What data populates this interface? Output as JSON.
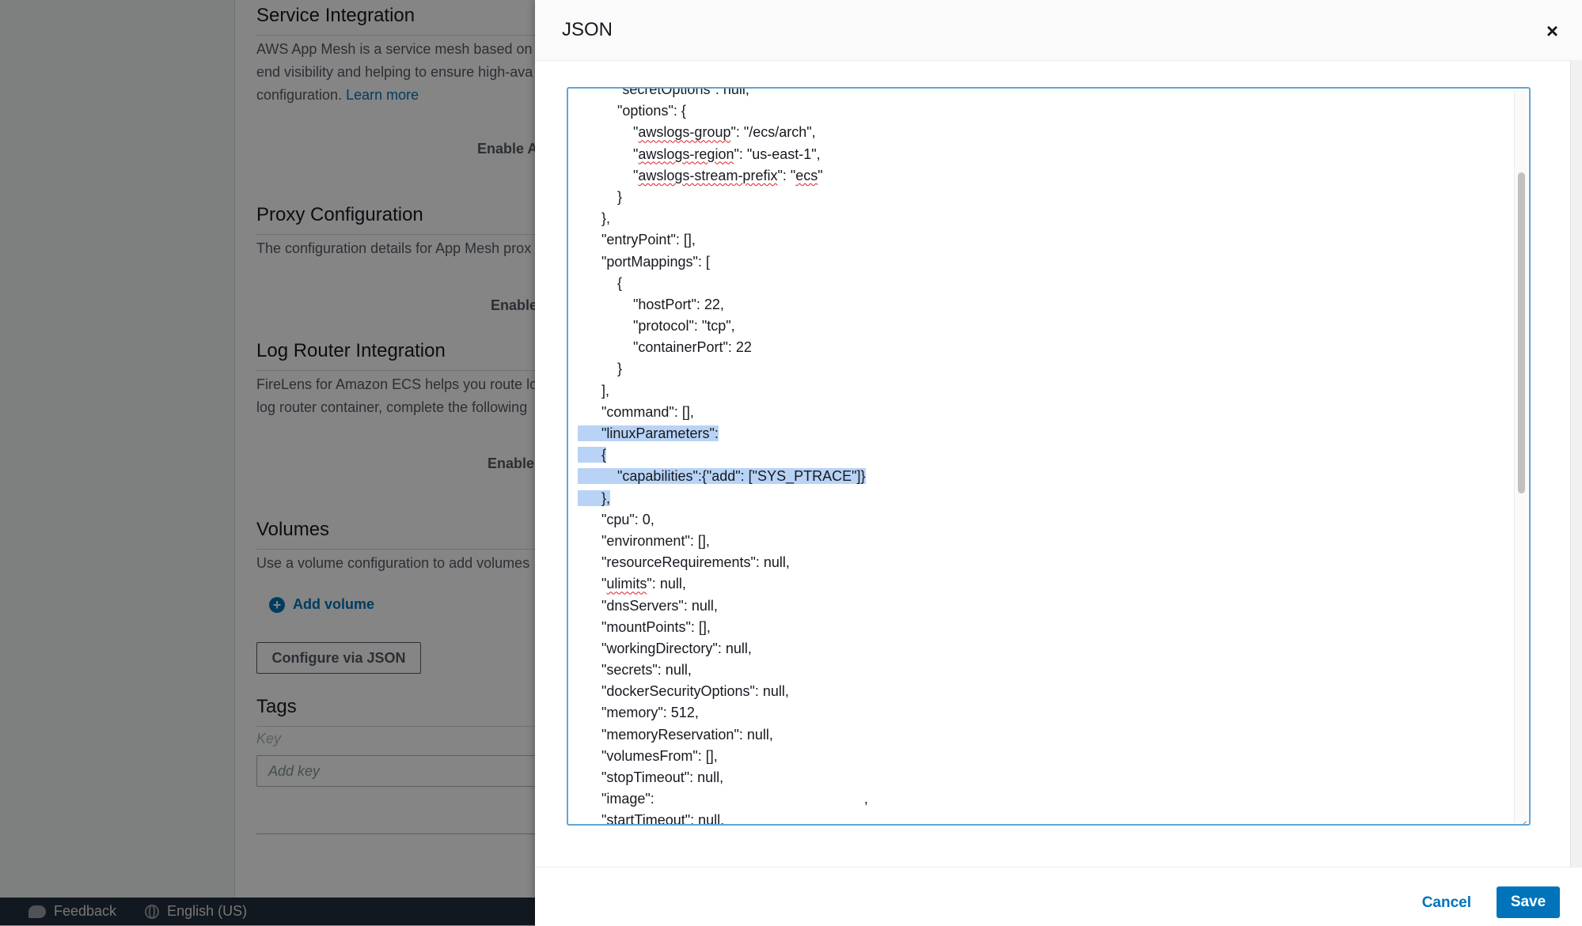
{
  "background": {
    "service_integration": {
      "title": "Service Integration",
      "desc1": "AWS App Mesh is a service mesh based on",
      "desc2": "end visibility and helping to ensure high-ava",
      "desc3": "configuration.",
      "learn_more": "Learn more",
      "enable_label": "Enable A"
    },
    "proxy_configuration": {
      "title": "Proxy Configuration",
      "desc": "The configuration details for App Mesh prox",
      "enable_label": "Enable"
    },
    "log_router": {
      "title": "Log Router Integration",
      "desc1": "FireLens for Amazon ECS helps you route lo",
      "desc2": "log router container, complete the following",
      "enable_label": "Enable"
    },
    "volumes": {
      "title": "Volumes",
      "desc": "Use a volume configuration to add volumes",
      "add_volume": "Add volume",
      "configure_json": "Configure via JSON"
    },
    "tags": {
      "title": "Tags",
      "key_label": "Key",
      "key_placeholder": "Add key"
    }
  },
  "footer": {
    "feedback": "Feedback",
    "language": "English (US)"
  },
  "modal": {
    "title": "JSON",
    "close": "×",
    "cancel": "Cancel",
    "save": "Save",
    "code_lines": [
      "          \"secretOptions\": null,",
      "          \"options\": {",
      "              \"awslogs-group\": \"/ecs/arch\",",
      "              \"awslogs-region\": \"us-east-1\",",
      "              \"awslogs-stream-prefix\": \"ecs\"",
      "          }",
      "      },",
      "      \"entryPoint\": [],",
      "      \"portMappings\": [",
      "          {",
      "              \"hostPort\": 22,",
      "              \"protocol\": \"tcp\",",
      "              \"containerPort\": 22",
      "          }",
      "      ],",
      "      \"command\": [],",
      "      \"linuxParameters\":",
      "      {",
      "          \"capabilities\":{\"add\": [\"SYS_PTRACE\"]}",
      "      },",
      "      \"cpu\": 0,",
      "      \"environment\": [],",
      "      \"resourceRequirements\": null,",
      "      \"ulimits\": null,",
      "      \"dnsServers\": null,",
      "      \"mountPoints\": [],",
      "      \"workingDirectory\": null,",
      "      \"secrets\": null,",
      "      \"dockerSecurityOptions\": null,",
      "      \"memory\": 512,",
      "      \"memoryReservation\": null,",
      "      \"volumesFrom\": [],",
      "      \"stopTimeout\": null,",
      "      \"image\":                                                     ,",
      "      \"startTimeout\": null,"
    ],
    "selected_lines": [
      16,
      17,
      18,
      19
    ]
  }
}
